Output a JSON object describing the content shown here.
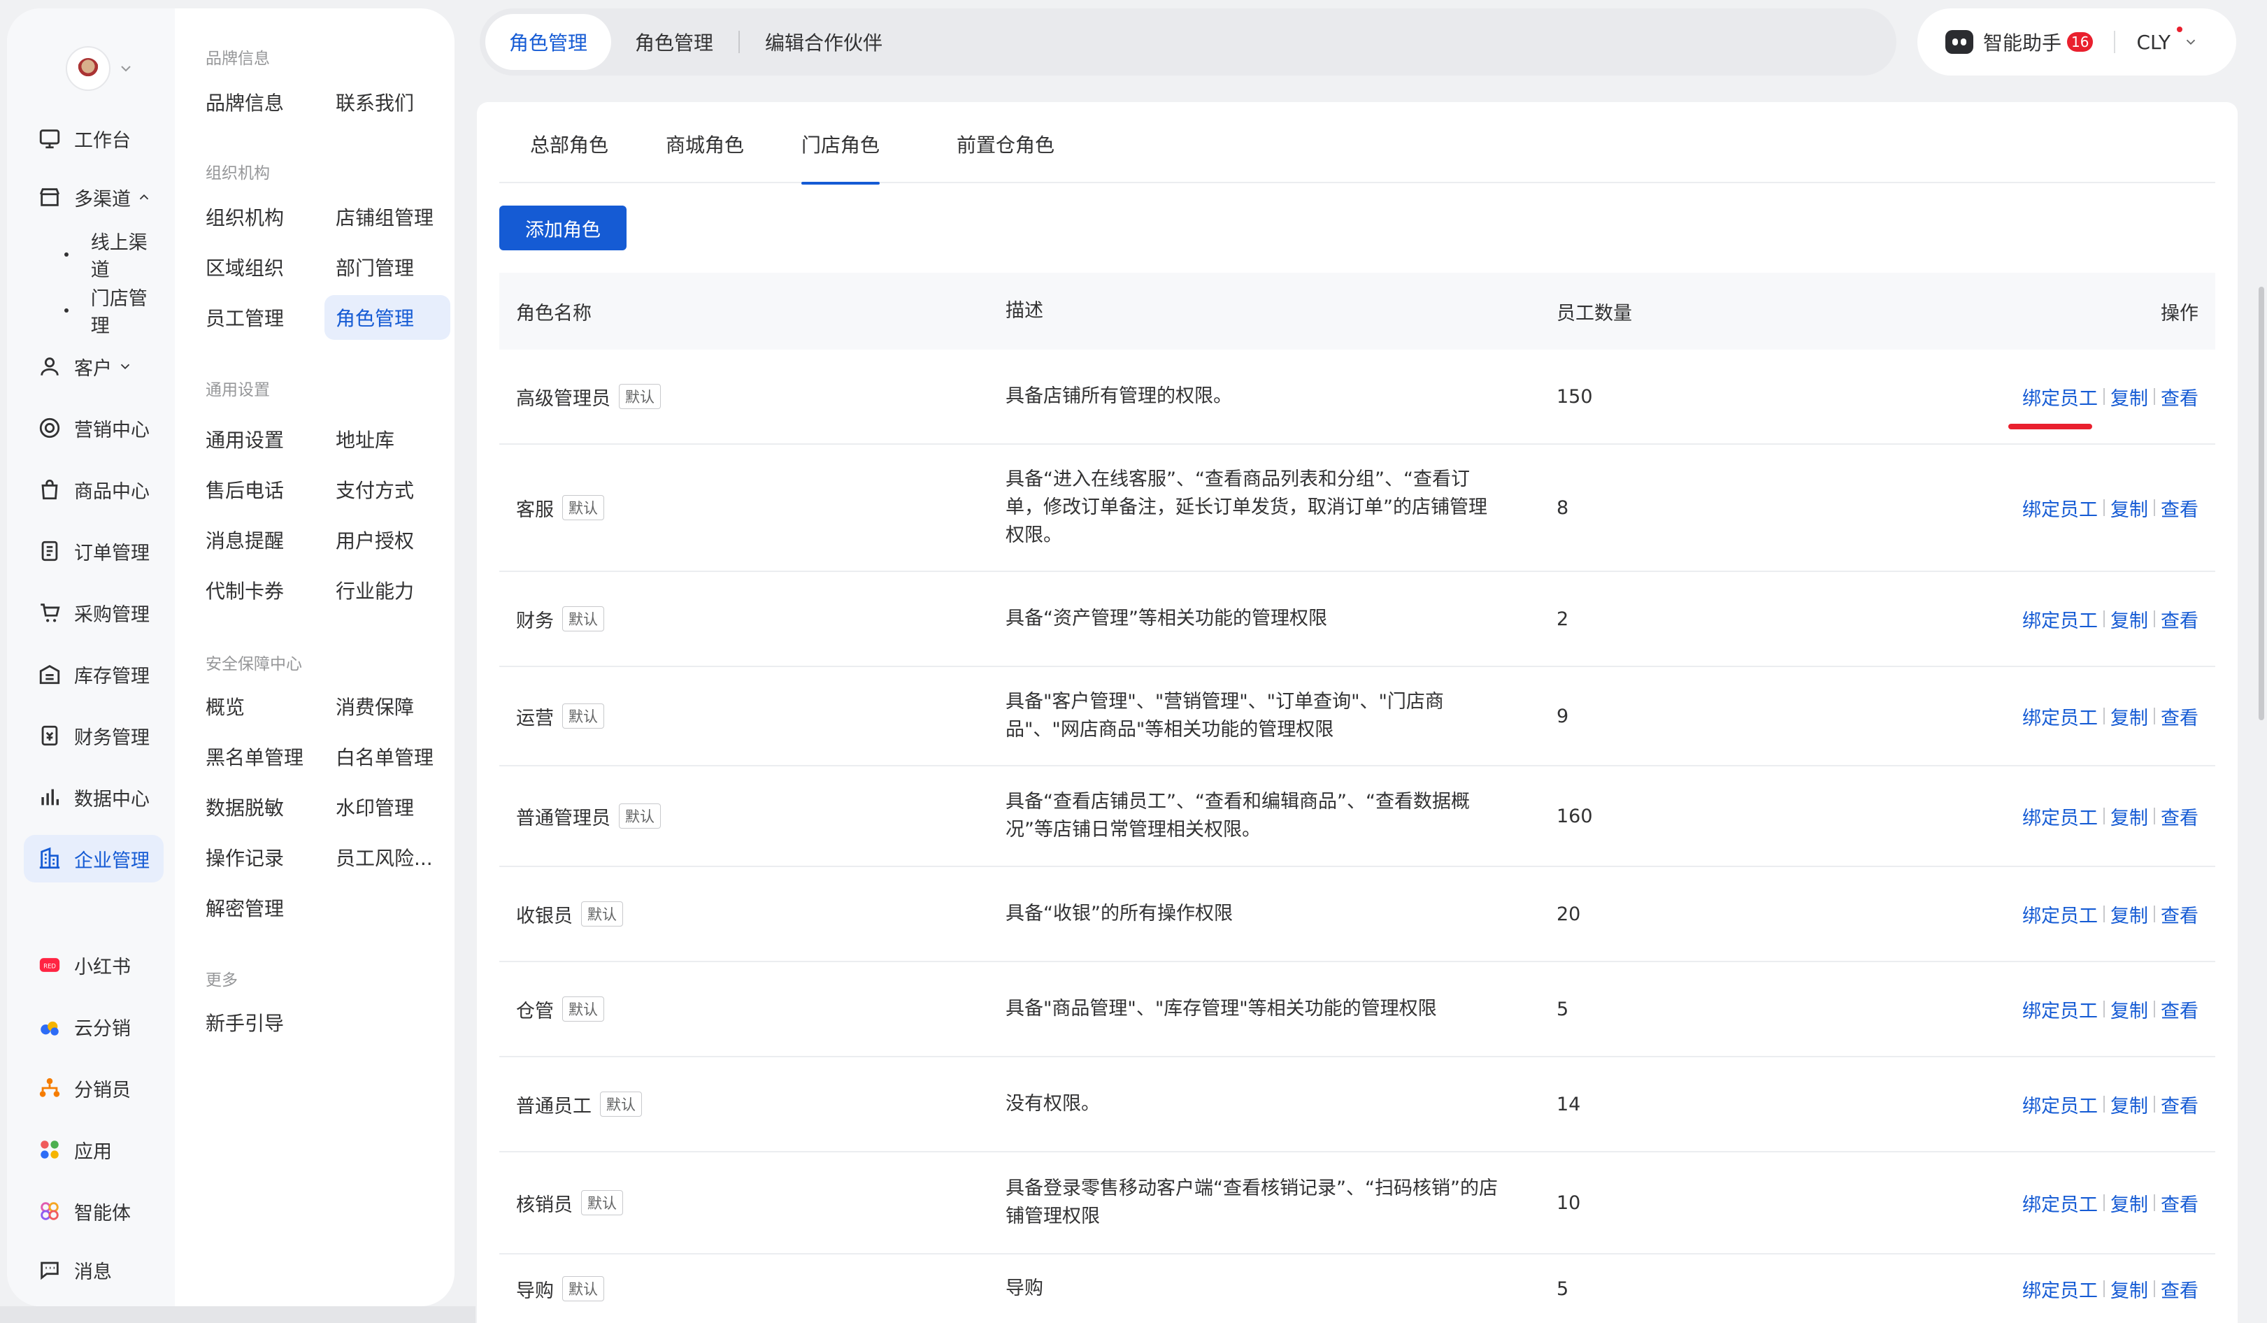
{
  "primary_nav": {
    "items": [
      {
        "label": "工作台",
        "icon": "workbench-icon"
      },
      {
        "label": "多渠道",
        "icon": "store-icon",
        "expanded": true
      },
      {
        "label": "线上渠道",
        "sub": true
      },
      {
        "label": "门店管理",
        "sub": true
      },
      {
        "label": "客户",
        "icon": "user-icon"
      },
      {
        "label": "营销中心",
        "icon": "target-icon"
      },
      {
        "label": "商品中心",
        "icon": "bag-icon"
      },
      {
        "label": "订单管理",
        "icon": "order-icon"
      },
      {
        "label": "采购管理",
        "icon": "cart-icon"
      },
      {
        "label": "库存管理",
        "icon": "warehouse-icon"
      },
      {
        "label": "财务管理",
        "icon": "finance-icon"
      },
      {
        "label": "数据中心",
        "icon": "chart-icon"
      },
      {
        "label": "企业管理",
        "icon": "building-icon",
        "active": true
      },
      {
        "label": "小红书",
        "icon": "xiaohongshu-icon"
      },
      {
        "label": "云分销",
        "icon": "cloud-distribution-icon"
      },
      {
        "label": "分销员",
        "icon": "distributor-icon"
      },
      {
        "label": "应用",
        "icon": "apps-icon"
      },
      {
        "label": "智能体",
        "icon": "agent-icon"
      },
      {
        "label": "消息",
        "icon": "message-icon"
      }
    ]
  },
  "secondary_nav": {
    "groups": [
      {
        "title": "品牌信息",
        "items": [
          "品牌信息",
          "联系我们"
        ]
      },
      {
        "title": "组织机构",
        "items": [
          "组织机构",
          "店铺组管理",
          "区域组织",
          "部门管理",
          "员工管理",
          "角色管理"
        ]
      },
      {
        "title": "通用设置",
        "items": [
          "通用设置",
          "地址库",
          "售后电话",
          "支付方式",
          "消息提醒",
          "用户授权",
          "代制卡券",
          "行业能力"
        ]
      },
      {
        "title": "安全保障中心",
        "items": [
          "概览",
          "消费保障",
          "黑名单管理",
          "白名单管理",
          "数据脱敏",
          "水印管理",
          "操作记录",
          "员工风险...",
          "解密管理"
        ]
      },
      {
        "title": "更多",
        "items": [
          "新手引导"
        ]
      }
    ],
    "active_item": "角色管理"
  },
  "topbar": {
    "tabs": [
      "角色管理",
      "角色管理",
      "编辑合作伙伴"
    ],
    "active_index": 0,
    "assistant_label": "智能助手",
    "assistant_badge": "16",
    "user_label": "CLY"
  },
  "sub_tabs": {
    "items": [
      "总部角色",
      "商城角色",
      "门店角色",
      "前置仓角色"
    ],
    "active_index": 2
  },
  "add_button_label": "添加角色",
  "table": {
    "headers": [
      "角色名称",
      "描述",
      "员工数量",
      "操作"
    ],
    "tag_label": "默认",
    "ops": [
      "绑定员工",
      "复制",
      "查看"
    ],
    "rows": [
      {
        "name": "高级管理员",
        "desc": "具备店铺所有管理的权限。",
        "count": "150"
      },
      {
        "name": "客服",
        "desc": "具备“进入在线客服”、“查看商品列表和分组”、“查看订单，修改订单备注，延长订单发货，取消订单”的店铺管理权限。",
        "count": "8"
      },
      {
        "name": "财务",
        "desc": "具备“资产管理”等相关功能的管理权限",
        "count": "2"
      },
      {
        "name": "运营",
        "desc": "具备\"客户管理\"、\"营销管理\"、\"订单查询\"、\"门店商品\"、\"网店商品\"等相关功能的管理权限",
        "count": "9"
      },
      {
        "name": "普通管理员",
        "desc": "具备“查看店铺员工”、“查看和编辑商品”、“查看数据概况”等店铺日常管理相关权限。",
        "count": "160"
      },
      {
        "name": "收银员",
        "desc": "具备“收银”的所有操作权限",
        "count": "20"
      },
      {
        "name": "仓管",
        "desc": "具备\"商品管理\"、\"库存管理\"等相关功能的管理权限",
        "count": "5"
      },
      {
        "name": "普通员工",
        "desc": "没有权限。",
        "count": "14"
      },
      {
        "name": "核销员",
        "desc": "具备登录零售移动客户端“查看核销记录”、“扫码核销”的店铺管理权限",
        "count": "10"
      },
      {
        "name": "导购",
        "desc": "导购",
        "count": "5"
      }
    ]
  },
  "colors": {
    "accent": "#155bd4",
    "badge": "#e9202e",
    "active_bg": "#e7eefc"
  }
}
